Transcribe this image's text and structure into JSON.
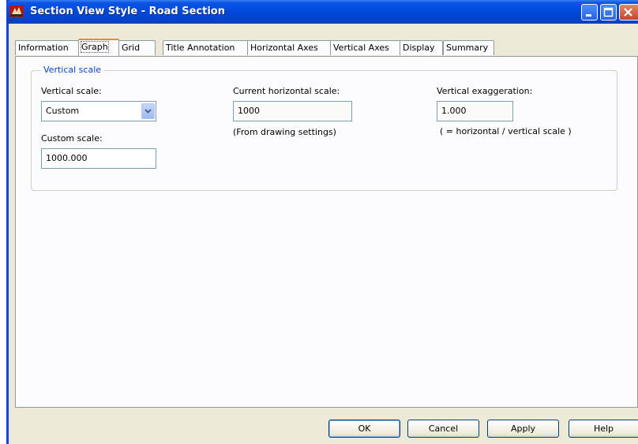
{
  "window": {
    "title": "Section View Style - Road Section"
  },
  "tabs": [
    {
      "label": "Information"
    },
    {
      "label": "Graph"
    },
    {
      "label": "Grid"
    },
    {
      "label": "Title Annotation"
    },
    {
      "label": "Horizontal Axes"
    },
    {
      "label": "Vertical Axes"
    },
    {
      "label": "Display"
    },
    {
      "label": "Summary"
    }
  ],
  "active_tab": "Graph",
  "group": {
    "title": "Vertical scale"
  },
  "vertical_scale": {
    "label": "Vertical scale:",
    "value": "Custom"
  },
  "custom_scale": {
    "label": "Custom scale:",
    "value": "1000.000"
  },
  "horizontal_scale": {
    "label": "Current horizontal scale:",
    "value": "1000",
    "note": "(From drawing settings)"
  },
  "exaggeration": {
    "label": "Vertical exaggeration:",
    "value": "1.000",
    "note": "( = horizontal / vertical scale )"
  },
  "buttons": {
    "ok": "OK",
    "cancel": "Cancel",
    "apply": "Apply",
    "help": "Help"
  },
  "colors": {
    "titlebar": "#0047d8",
    "accent": "#e68b2c",
    "group_title": "#0046d5",
    "face": "#ece9d8"
  }
}
